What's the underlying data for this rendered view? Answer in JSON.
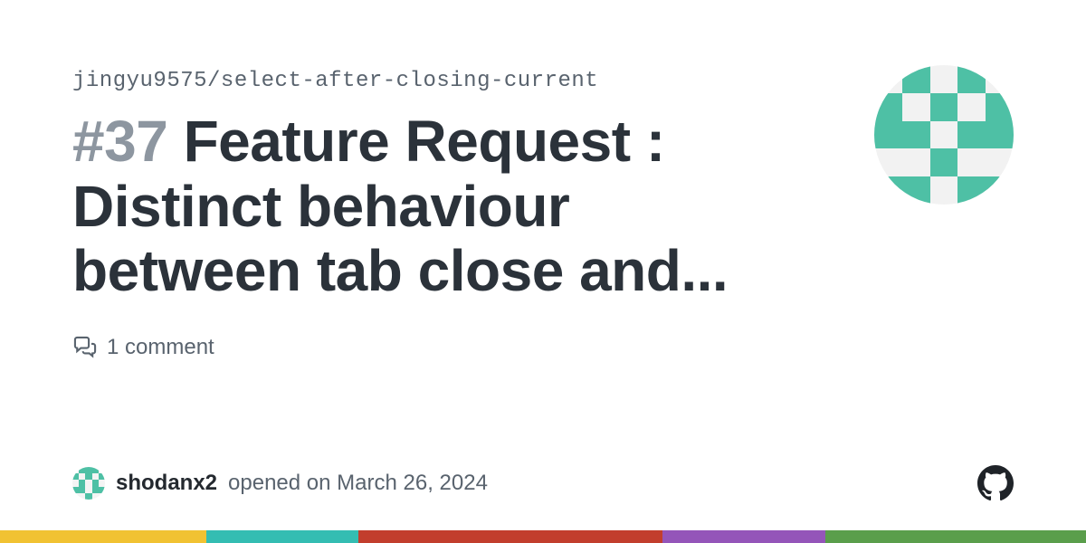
{
  "repo": "jingyu9575/select-after-closing-current",
  "issue": {
    "number_prefix": "#37",
    "title": "Feature Request : Distinct behaviour between tab close and...",
    "comments_text": "1 comment"
  },
  "author": {
    "username": "shodanx2",
    "opened_text": "opened on March 26, 2024"
  }
}
